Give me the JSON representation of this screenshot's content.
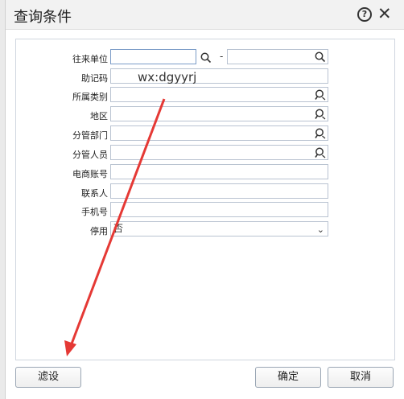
{
  "dialog": {
    "title": "查询条件"
  },
  "form": {
    "rows": [
      {
        "label": "往来单位"
      },
      {
        "label": "助记码"
      },
      {
        "label": "所属类别"
      },
      {
        "label": "地区"
      },
      {
        "label": "分管部门"
      },
      {
        "label": "分管人员"
      },
      {
        "label": "电商账号"
      },
      {
        "label": "联系人"
      },
      {
        "label": "手机号"
      },
      {
        "label": "停用",
        "value": "否"
      }
    ],
    "range_separator": "-"
  },
  "watermark": "wx:dgyyrj",
  "buttons": {
    "filter": "滤设",
    "ok": "确定",
    "cancel": "取消"
  },
  "colors": {
    "arrow": "#e53935"
  }
}
